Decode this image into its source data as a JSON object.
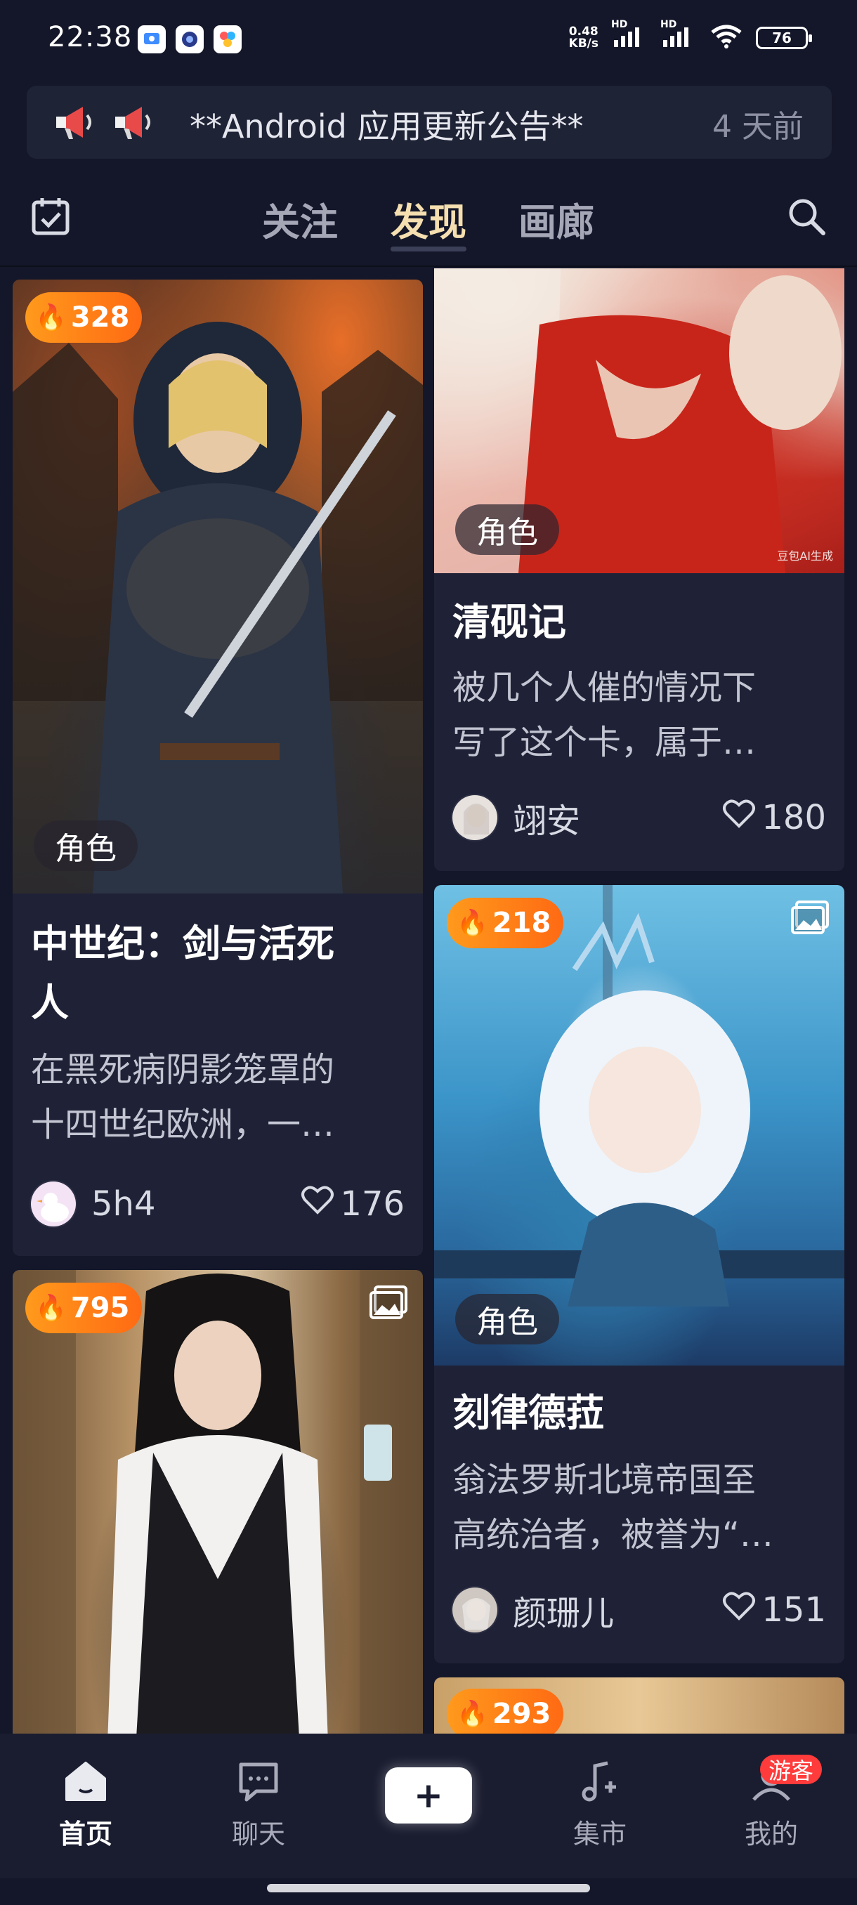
{
  "status_bar": {
    "time": "22:38",
    "net_speed_value": "0.48",
    "net_speed_unit": "KB/s",
    "signal_1_label": "HD",
    "signal_2_label": "HD",
    "battery_level": "76"
  },
  "announcement": {
    "text": "**Android 应用更新公告**",
    "time": "4 天前"
  },
  "top_nav": {
    "tabs": [
      {
        "label": "关注",
        "active": false
      },
      {
        "label": "发现",
        "active": true
      },
      {
        "label": "画廊",
        "active": false
      }
    ]
  },
  "cards": [
    {
      "column": "left",
      "hot_count": "328",
      "tag": "角色",
      "title_line1": "中世纪：剑与活死",
      "title_line2": "人",
      "desc_line1": "在黑死病阴影笼罩的",
      "desc_line2": "十四世纪欧洲，一…",
      "author": "5h4",
      "likes": "176"
    },
    {
      "column": "right",
      "tag": "角色",
      "image_watermark": "豆包AI生成",
      "title": "清砚记",
      "desc_line1": "被几个人催的情况下",
      "desc_line2": "写了这个卡，属于…",
      "author": "翊安",
      "likes": "180"
    },
    {
      "column": "right",
      "hot_count": "218",
      "tag": "角色",
      "has_gallery_icon": true,
      "title": "刻律德菈",
      "desc_line1": "翁法罗斯北境帝国至",
      "desc_line2": "高统治者，被誉为“…",
      "author": "颜珊儿",
      "likes": "151"
    },
    {
      "column": "left",
      "hot_count": "795",
      "has_gallery_icon": true
    },
    {
      "column": "right",
      "hot_count": "293"
    }
  ],
  "bottom_nav": {
    "items": [
      {
        "label": "首页",
        "icon": "home-icon",
        "active": true
      },
      {
        "label": "聊天",
        "icon": "chat-icon",
        "active": false
      },
      {
        "label": "+",
        "icon": "plus-icon",
        "active": false
      },
      {
        "label": "集市",
        "icon": "market-icon",
        "active": false
      },
      {
        "label": "我的",
        "icon": "profile-icon",
        "active": false
      }
    ],
    "guest_badge": "游客"
  },
  "colors": {
    "background": "#141729",
    "card": "#1f2236",
    "active_tab": "#f5dfb0",
    "hot_badge": "#ff7a18",
    "guest_badge": "#ff3b3b"
  }
}
